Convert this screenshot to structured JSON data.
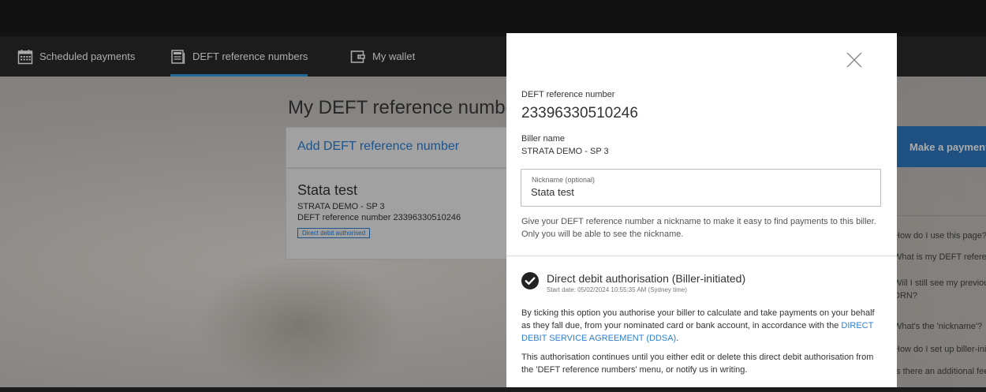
{
  "nav": {
    "items": [
      {
        "label": "Scheduled payments",
        "icon": "calendar-icon"
      },
      {
        "label": "DEFT reference numbers",
        "icon": "document-icon",
        "active": true
      },
      {
        "label": "My wallet",
        "icon": "wallet-icon"
      }
    ]
  },
  "page": {
    "title": "My DEFT reference numbers",
    "add_label": "Add DEFT reference number",
    "make_payment_label": "Make a payment",
    "reference_card": {
      "nickname": "Stata test",
      "biller": "STRATA DEMO - SP 3",
      "drn_line": "DEFT reference number 23396330510246",
      "badge": "Direct debit authorised"
    }
  },
  "faq": [
    "How do I use this page?",
    "What is my DEFT reference number?",
    "Will I still see my previous",
    "DRN?",
    "What's the 'nickname'?",
    "How do I set up biller-initiated",
    "Is there an additional fee?"
  ],
  "modal": {
    "drn_label": "DEFT reference number",
    "drn_value": "23396330510246",
    "biller_label": "Biller name",
    "biller_value": "STRATA DEMO - SP 3",
    "nickname_label": "Nickname (optional)",
    "nickname_value": "Stata test",
    "nickname_help": "Give your DEFT reference number a nickname to make it easy to find payments to this biller. Only you will be able to see the nickname.",
    "dd_title": "Direct debit authorisation (Biller-initiated)",
    "dd_start": "Start date: 05/02/2024 10:55:35 AM (Sydney time)",
    "dd_paragraph_pre": "By ticking this option you authorise your biller to calculate and take payments on your behalf as they fall due, from your nominated card or bank account, in accordance with the ",
    "dd_link": "DIRECT DEBIT SERVICE AGREEMENT (DDSA)",
    "dd_paragraph_post": ".",
    "dd_paragraph2": "This authorisation continues until you either edit or delete this direct debit authorisation from the 'DEFT reference numbers' menu, or notify us in writing."
  },
  "colors": {
    "accent": "#2f9be6",
    "link": "#2a7fd4",
    "primary_button": "#2f78c2",
    "nav_bg": "#2b2b2b"
  }
}
